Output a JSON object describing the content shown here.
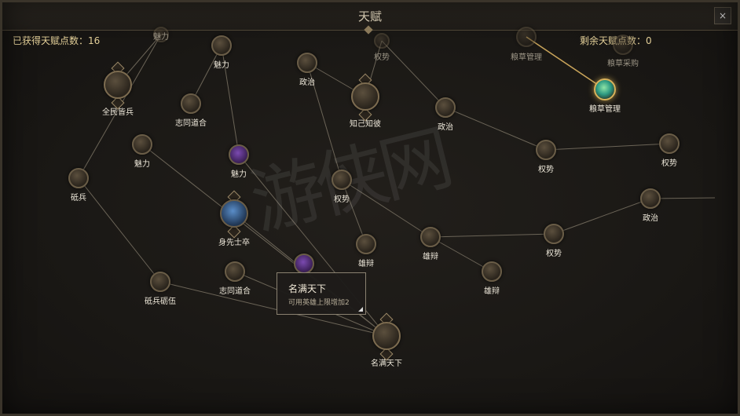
{
  "window": {
    "title": "天赋",
    "close_label": "×"
  },
  "points": {
    "earned": "已获得天赋点数：16",
    "remaining": "剩余天赋点数：0"
  },
  "watermark": "游侠网",
  "tooltip": {
    "title": "名满天下",
    "description": "可用英雄上限增加2"
  },
  "nodes": [
    {
      "id": "n01",
      "label": "魅力",
      "style": "faded"
    },
    {
      "id": "n02",
      "label": "全民皆兵",
      "style": "large"
    },
    {
      "id": "n03",
      "label": "魅力",
      "style": "normal"
    },
    {
      "id": "n04",
      "label": "政治",
      "style": "normal"
    },
    {
      "id": "n05",
      "label": "权势",
      "style": "faded"
    },
    {
      "id": "n06",
      "label": "粮草管理",
      "style": "faded"
    },
    {
      "id": "n07",
      "label": "粮草采购",
      "style": "faded"
    },
    {
      "id": "n08",
      "label": "粮草管理",
      "style": "owned"
    },
    {
      "id": "n09",
      "label": "志同道合",
      "style": "normal"
    },
    {
      "id": "n10",
      "label": "知己知彼",
      "style": "large"
    },
    {
      "id": "n11",
      "label": "政治",
      "style": "normal"
    },
    {
      "id": "n12",
      "label": "魅力",
      "style": "normal"
    },
    {
      "id": "n13",
      "label": "魅力",
      "style": "purple"
    },
    {
      "id": "n14",
      "label": "权势",
      "style": "normal"
    },
    {
      "id": "n15",
      "label": "雄辩",
      "style": "normal"
    },
    {
      "id": "n16",
      "label": "砥兵",
      "style": "normal"
    },
    {
      "id": "n17",
      "label": "权势",
      "style": "normal"
    },
    {
      "id": "n18",
      "label": "身先士卒",
      "style": "blue"
    },
    {
      "id": "n19",
      "label": "权势",
      "style": "normal"
    },
    {
      "id": "n20",
      "label": "雄辩",
      "style": "normal"
    },
    {
      "id": "n21",
      "label": "政治",
      "style": "normal"
    },
    {
      "id": "n22",
      "label": "权势",
      "style": "normal"
    },
    {
      "id": "n23",
      "label": "雄辩",
      "style": "normal"
    },
    {
      "id": "n24",
      "label": "砥兵砺伍",
      "style": "normal"
    },
    {
      "id": "n25",
      "label": "志同道合",
      "style": "normal"
    },
    {
      "id": "n26",
      "label": "",
      "style": "purple"
    },
    {
      "id": "n27",
      "label": "名满天下",
      "style": "large"
    }
  ]
}
